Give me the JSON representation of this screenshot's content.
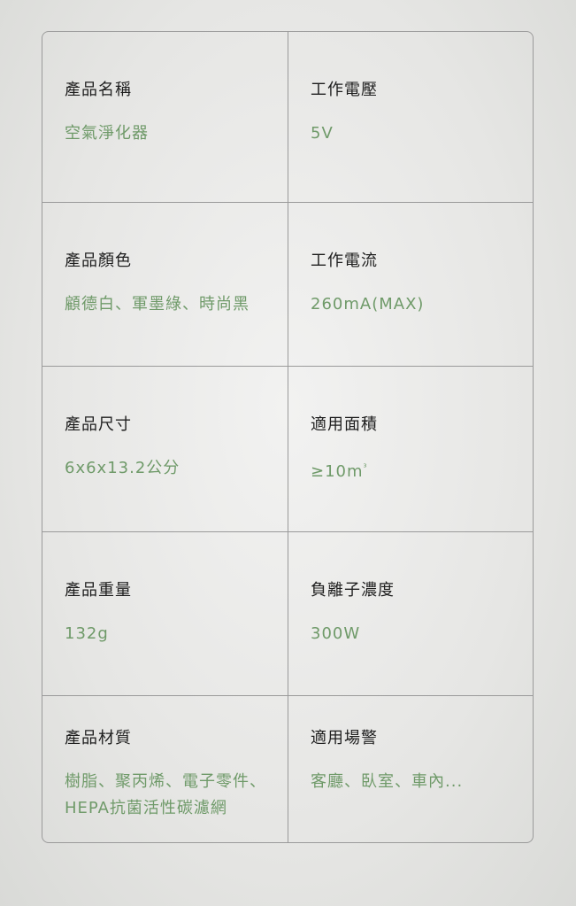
{
  "specs": [
    {
      "label": "產品名稱",
      "value": "空氣淨化器"
    },
    {
      "label": "工作電壓",
      "value": "5V"
    },
    {
      "label": "產品顏色",
      "value": "顧德白、軍墨綠、時尚黑"
    },
    {
      "label": "工作電流",
      "value": "260mA(MAX)"
    },
    {
      "label": "產品尺寸",
      "value": "6x6x13.2公分"
    },
    {
      "label": "適用面積",
      "value": "≥10m",
      "value_sup": "³"
    },
    {
      "label": "產品重量",
      "value": "132g"
    },
    {
      "label": "負離子濃度",
      "value": "300W"
    },
    {
      "label": "產品材質",
      "value_line1": "樹脂、聚丙烯、電子零件、",
      "value_line2": "HEPA抗菌活性碳濾網"
    },
    {
      "label": "適用場警",
      "value": "客廳、臥室、車內..."
    }
  ],
  "colors": {
    "label": "#1e1e1e",
    "value": "#6f9a69",
    "border": "#9a9a9a"
  }
}
